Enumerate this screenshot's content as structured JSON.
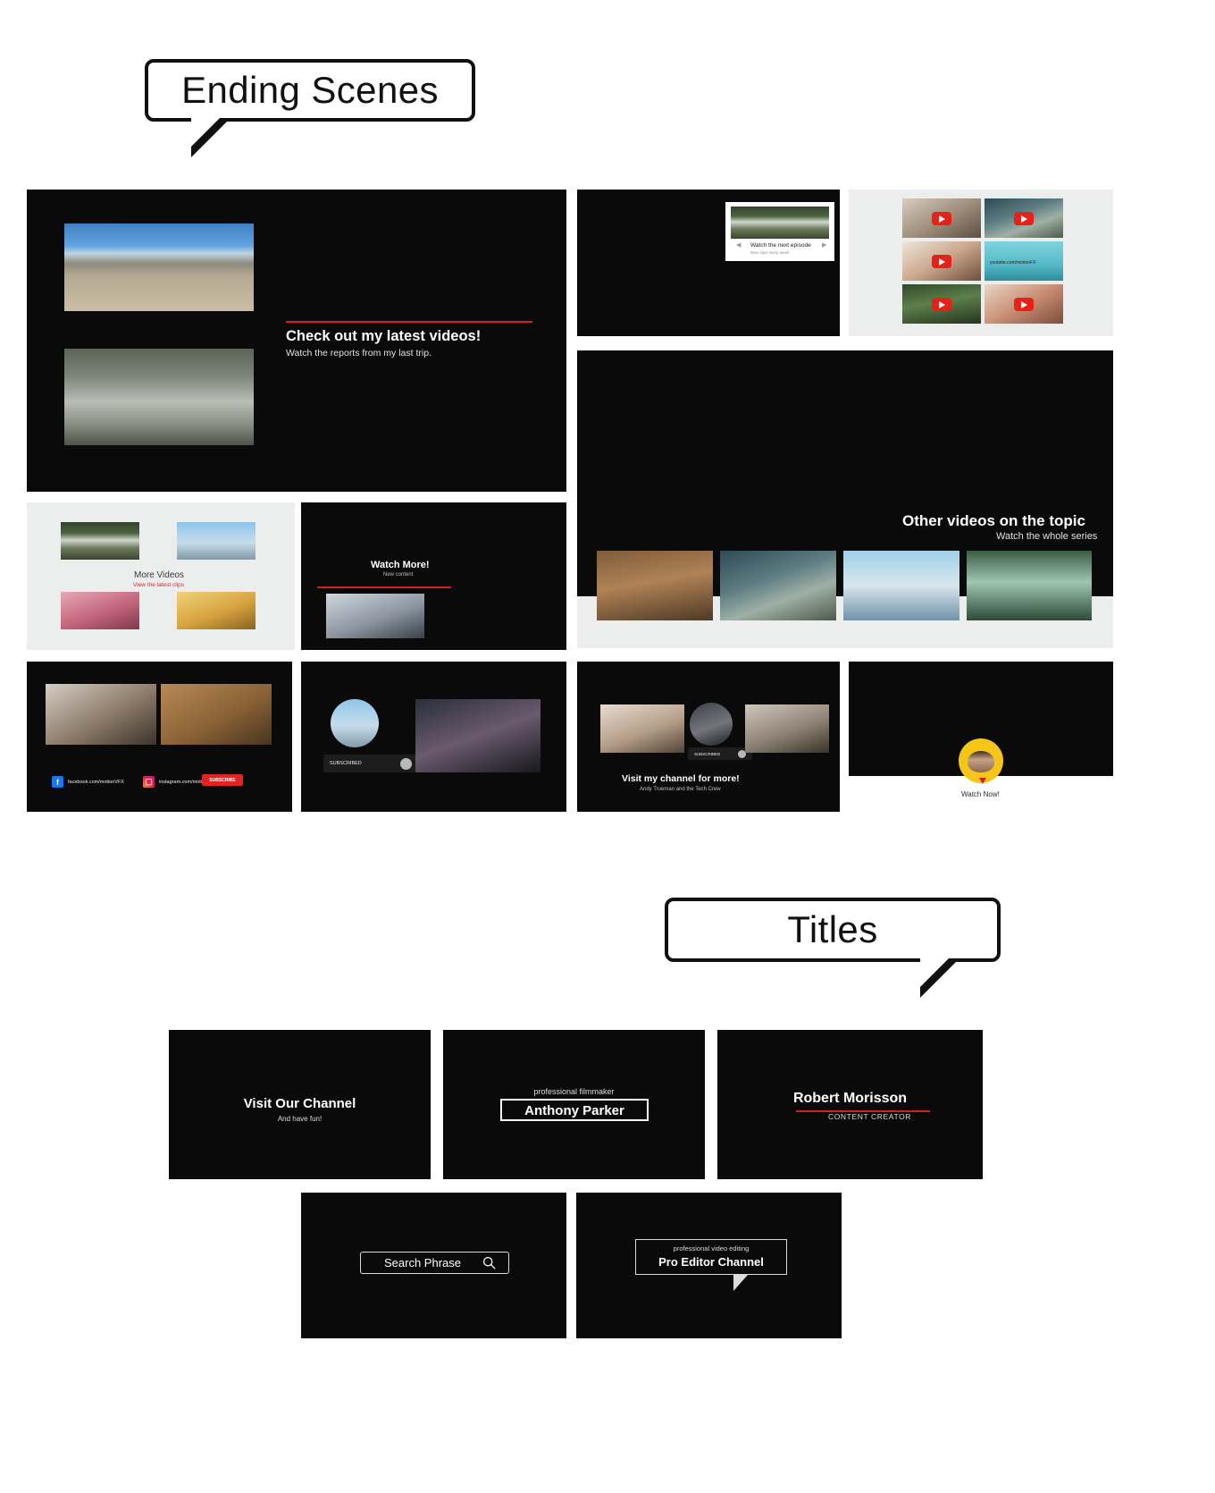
{
  "sections": {
    "ending_scenes": {
      "label": "Ending Scenes"
    },
    "titles": {
      "label": "Titles"
    }
  },
  "scenes": {
    "latest_videos": {
      "title": "Check out my latest videos!",
      "subtitle": "Watch the reports from my last trip."
    },
    "next_episode": {
      "title": "Watch the next episode",
      "subtitle": "New clips every week"
    },
    "grid_channel_url": "youtube.com/motionFX",
    "more_videos": {
      "title": "More Videos",
      "subtitle": "View the latest clips"
    },
    "watch_more": {
      "title": "Watch More!",
      "subtitle": "New content"
    },
    "other_videos": {
      "title": "Other videos on the topic",
      "subtitle": "Watch the whole series"
    },
    "social_bar": {
      "facebook": "facebook.com/motionVFX",
      "instagram": "instagram.com/motionVFX",
      "subscribe": "SUBSCRIBE"
    },
    "subscribed_pill": {
      "label": "SUBSCRIBED"
    },
    "visit_channel": {
      "title": "Visit my channel for more!",
      "subtitle": "Andy Trueman and the Tech Crew",
      "pill": "SUBSCRIBED"
    },
    "watch_now": {
      "label": "Watch Now!"
    }
  },
  "titles": {
    "visit_our_channel": {
      "line1": "Visit Our Channel",
      "line2": "And have fun!"
    },
    "anthony_parker": {
      "kicker": "professional filmmaker",
      "name": "Anthony Parker"
    },
    "robert_morisson": {
      "name": "Robert Morisson",
      "role": "CONTENT CREATOR"
    },
    "search_phrase": {
      "label": "Search Phrase",
      "icon": "search-icon"
    },
    "pro_editor": {
      "kicker": "professional video editing",
      "name": "Pro Editor Channel"
    }
  },
  "colors": {
    "accent_red": "#d32020",
    "youtube_red": "#e62117",
    "panel_dark": "#0a0a0a",
    "panel_light": "#eceded"
  }
}
